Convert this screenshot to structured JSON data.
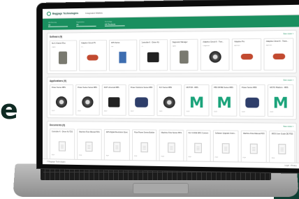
{
  "background": {
    "letter": "e",
    "accent": "#0f3f33"
  },
  "app": {
    "brand": "Baggage Technologies",
    "tab": "Integrated Wallets"
  },
  "filters": [
    {
      "label": "Unit Directory",
      "value": "All"
    },
    {
      "label": "Organization",
      "value": "All"
    },
    {
      "label": "Technology",
      "value": "All Products"
    }
  ],
  "sections": [
    {
      "title": "Software (9)",
      "more": "See more >",
      "cards": [
        {
          "title": "SLX-3 Switch Plus",
          "sub": "Digital",
          "icon": "device-icon",
          "shape": "gray",
          "foot": ""
        },
        {
          "title": "Adaptive Circuit PV",
          "sub": "DC",
          "icon": "cable-icon",
          "shape": "red",
          "foot": ""
        },
        {
          "title": "APS Series",
          "sub": "Yes",
          "icon": "rack-icon",
          "shape": "blue",
          "foot": ""
        },
        {
          "title": "Controller K - Driver Kit",
          "sub": "DC",
          "icon": "controller-icon",
          "shape": "dark",
          "foot": ""
        },
        {
          "title": "Diagnostic Manager",
          "sub": "Digital",
          "icon": "module-icon",
          "shape": "gray",
          "foot": ""
        },
        {
          "title": "Adaptive Circuit K - Tran...",
          "sub": "Diagnostic",
          "icon": "cable-icon",
          "shape": "round",
          "foot": ""
        },
        {
          "title": "Adaptive Pro",
          "sub": "Aperture",
          "icon": "cable-icon",
          "shape": "red",
          "foot": ""
        },
        {
          "title": "Adaptive Circuit K - Trans...",
          "sub": "Aperture",
          "icon": "cable-icon",
          "shape": "red",
          "foot": ""
        }
      ]
    },
    {
      "title": "Applications (9)",
      "more": "See more >",
      "cards": [
        {
          "title": "Power Series RBS",
          "sub": "",
          "icon": "turbine-icon",
          "shape": "round",
          "foot": "2022"
        },
        {
          "title": "Power Series Series RBS",
          "sub": "",
          "icon": "turbine-icon",
          "shape": "round",
          "foot": "2022"
        },
        {
          "title": "DCP Universal RBS",
          "sub": "",
          "icon": "turbine-icon",
          "shape": "dark",
          "foot": "2022"
        },
        {
          "title": "Power Solutions Series RBS",
          "sub": "",
          "icon": "engine-icon",
          "shape": "engine",
          "foot": "2022"
        },
        {
          "title": "FLX Series RBS",
          "sub": "",
          "icon": "turbine-icon",
          "shape": "round",
          "foot": "2022"
        },
        {
          "title": "MOTOR - RBS",
          "sub": "",
          "icon": "m-logo-icon",
          "shape": "m",
          "foot": "2022"
        },
        {
          "title": "PBS SPIRE Series RBS",
          "sub": "",
          "icon": "m-logo-icon",
          "shape": "m",
          "foot": "2022"
        },
        {
          "title": "Power Series RBS",
          "sub": "",
          "icon": "engine-icon",
          "shape": "engine",
          "foot": "2022"
        },
        {
          "title": "MOTO Platform - RBS",
          "sub": "",
          "icon": "m-logo-icon",
          "shape": "m",
          "foot": "2022"
        }
      ]
    },
    {
      "title": "Documents (9)",
      "more": "See more >",
      "cards": [
        {
          "title": "Controller K - Driver Kit TDS",
          "sub": "",
          "icon": "document-icon",
          "shape": "doc",
          "foot": "PDF"
        },
        {
          "title": "Machine Flow Manual PDS",
          "sub": "",
          "icon": "document-icon",
          "shape": "doc",
          "foot": "PDF"
        },
        {
          "title": "APS Digital Revolution Spec",
          "sub": "",
          "icon": "document-icon",
          "shape": "doc",
          "foot": "PDF"
        },
        {
          "title": "Flow Power Series Builder",
          "sub": "",
          "icon": "document-icon",
          "shape": "doc",
          "foot": "PDF"
        },
        {
          "title": "Machine Flow Series PDS",
          "sub": "",
          "icon": "document-icon",
          "shape": "doc",
          "foot": "PDF"
        },
        {
          "title": "FLX CODE DRC Content",
          "sub": "",
          "icon": "document-icon",
          "shape": "doc",
          "foot": "PDF"
        },
        {
          "title": "Software Upgrade Instru...",
          "sub": "",
          "icon": "document-icon",
          "shape": "doc",
          "foot": "PDF"
        },
        {
          "title": "Machine Flow Manual PDS",
          "sub": "",
          "icon": "document-icon",
          "shape": "doc",
          "foot": "PDF"
        },
        {
          "title": "MOS User Guide DE PDS",
          "sub": "",
          "icon": "document-icon",
          "shape": "doc",
          "foot": "PDF"
        }
      ]
    }
  ],
  "footer": {
    "left": "© Baggage Technologies",
    "right": "Legal · Privacy"
  }
}
